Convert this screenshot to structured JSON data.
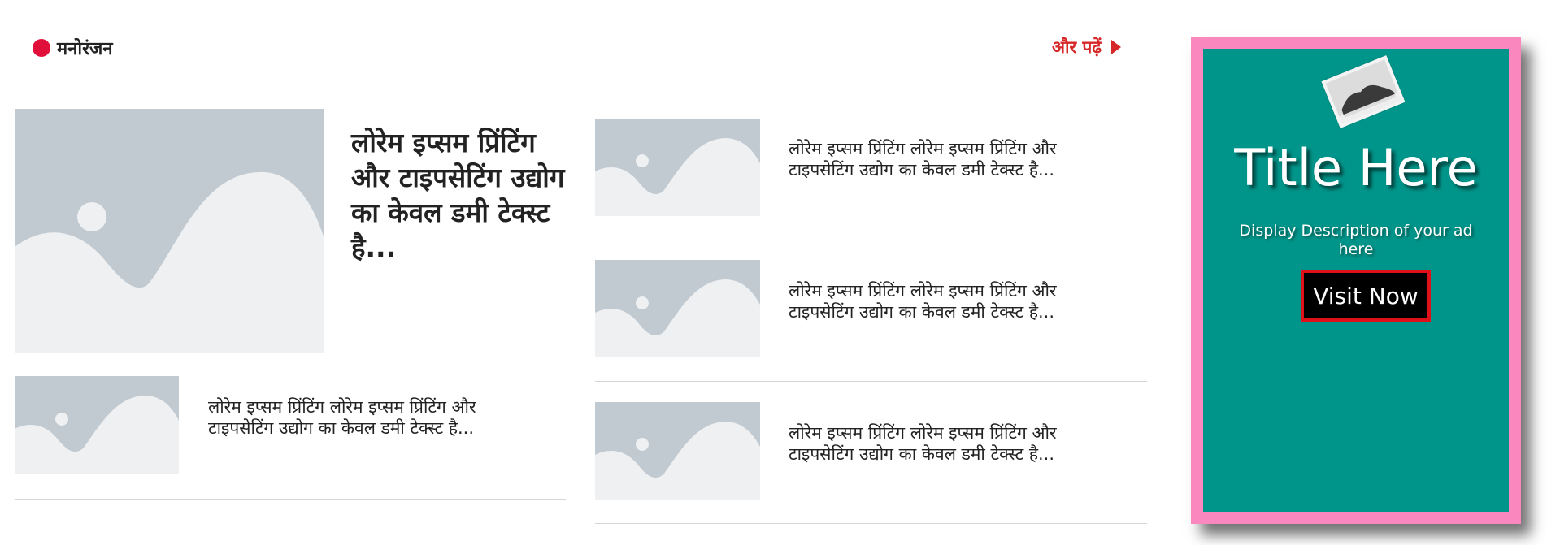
{
  "section": {
    "title": "मनोरंजन",
    "more_label": "और पढ़ें"
  },
  "featured": {
    "title": "लोरेम इप्सम प्रिंटिंग और टाइपसेटिंग उद्योग का केवल डमी टेक्स्ट है..."
  },
  "left_list": [
    {
      "text": "लोरेम इप्सम प्रिंटिंग लोरेम इप्सम प्रिंटिंग और टाइपसेटिंग उद्योग का केवल डमी टेक्स्ट है..."
    }
  ],
  "right_list": [
    {
      "text": "लोरेम इप्सम प्रिंटिंग लोरेम इप्सम प्रिंटिंग और टाइपसेटिंग उद्योग का केवल डमी टेक्स्ट है..."
    },
    {
      "text": "लोरेम इप्सम प्रिंटिंग लोरेम इप्सम प्रिंटिंग और टाइपसेटिंग उद्योग का केवल डमी टेक्स्ट है..."
    },
    {
      "text": "लोरेम इप्सम प्रिंटिंग लोरेम इप्सम प्रिंटिंग और टाइपसेटिंग उद्योग का केवल डमी टेक्स्ट है..."
    }
  ],
  "ad": {
    "title": "Title Here",
    "description": "Display Description of your ad here",
    "button_label": "Visit Now"
  },
  "colors": {
    "accent_red": "#e0103a",
    "more_link": "#d62828",
    "ad_border": "#fa88be",
    "ad_bg": "#00958a",
    "ad_button_border": "#e0101a",
    "placeholder_bg": "#c1c9d1",
    "placeholder_fg": "#eef0f2"
  },
  "icons": {
    "section_marker": "red-dot-icon",
    "more_arrow": "triangle-right-icon",
    "thumbnail": "image-placeholder-icon"
  }
}
